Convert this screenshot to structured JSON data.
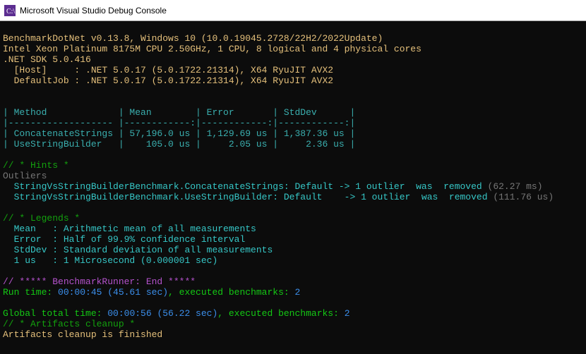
{
  "titlebar": {
    "title": "Microsoft Visual Studio Debug Console"
  },
  "header": {
    "line1": "BenchmarkDotNet v0.13.8, Windows 10 (10.0.19045.2728/22H2/2022Update)",
    "line2": "Intel Xeon Platinum 8175M CPU 2.50GHz, 1 CPU, 8 logical and 4 physical cores",
    "line3": ".NET SDK 5.0.416",
    "line4": "  [Host]     : .NET 5.0.17 (5.0.1722.21314), X64 RyuJIT AVX2",
    "line5": "  DefaultJob : .NET 5.0.17 (5.0.1722.21314), X64 RyuJIT AVX2"
  },
  "table": {
    "head": "| Method             | Mean        | Error       | StdDev      |",
    "sep": "|------------------- |------------:|------------:|------------:|",
    "row1": "| ConcatenateStrings | 57,196.0 us | 1,129.69 us | 1,387.36 us |",
    "row2": "| UseStringBuilder   |    105.0 us |     2.05 us |     2.36 us |"
  },
  "hints": {
    "title": "// * Hints *",
    "outliers_label": "Outliers",
    "o1a": "  StringVsStringBuilderBenchmark.ConcatenateStrings: Default -> 1 outlier  was  removed",
    "o1b": " (62.27 ms)",
    "o2a": "  StringVsStringBuilderBenchmark.UseStringBuilder: Default    -> 1 outlier  was  removed",
    "o2b": " (111.76 us)"
  },
  "legends": {
    "title": "// * Legends *",
    "l1": "  Mean   : Arithmetic mean of all measurements",
    "l2": "  Error  : Half of 99.9% confidence interval",
    "l3": "  StdDev : Standard deviation of all measurements",
    "l4": "  1 us   : 1 Microsecond (0.000001 sec)"
  },
  "footer": {
    "runner_end": "// ***** BenchmarkRunner: End *****",
    "runtime_a": "Run time: ",
    "runtime_b": "00:00:45 (45.61 sec)",
    "runtime_c": ", executed benchmarks: ",
    "runtime_d": "2",
    "global_a": "Global total time: ",
    "global_b": "00:00:56 (56.22 sec)",
    "global_c": ", executed benchmarks: ",
    "global_d": "2",
    "artifacts_title": "// * Artifacts cleanup *",
    "artifacts_done": "Artifacts cleanup is finished"
  },
  "chart_data": {
    "type": "table",
    "columns": [
      "Method",
      "Mean",
      "Error",
      "StdDev"
    ],
    "rows": [
      {
        "Method": "ConcatenateStrings",
        "Mean": "57,196.0 us",
        "Error": "1,129.69 us",
        "StdDev": "1,387.36 us"
      },
      {
        "Method": "UseStringBuilder",
        "Mean": "105.0 us",
        "Error": "2.05 us",
        "StdDev": "2.36 us"
      }
    ]
  }
}
